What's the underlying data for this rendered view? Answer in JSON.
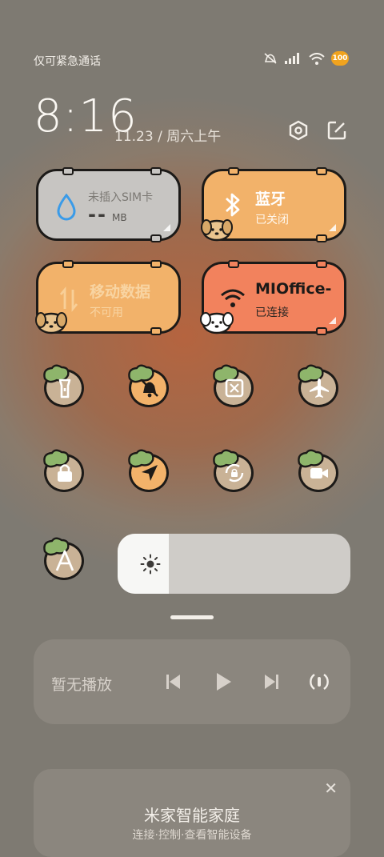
{
  "status_bar": {
    "carrier_text": "仅可紧急通话",
    "battery_level": "100",
    "icons": [
      "mute-icon",
      "signal-icon",
      "wifi-icon",
      "battery-icon"
    ]
  },
  "header": {
    "time": "8:16",
    "date": "11.23 / 周六上午",
    "icons": [
      "settings-icon",
      "edit-icon"
    ]
  },
  "tiles": {
    "sim": {
      "title": "未插入SIM卡",
      "value": "--",
      "unit": "MB",
      "icon": "water-drop-icon"
    },
    "bluetooth": {
      "title": "蓝牙",
      "status": "已关闭",
      "icon": "bluetooth-icon"
    },
    "mobile_data": {
      "title": "移动数据",
      "status": "不可用",
      "icon": "data-arrows-icon"
    },
    "wifi": {
      "title": "MIOffice-",
      "status": "已连接",
      "icon": "wifi-icon"
    }
  },
  "toggles_row1": [
    "flashlight-icon",
    "bell-mute-icon",
    "screenshot-icon",
    "airplane-icon"
  ],
  "toggles_row2": [
    "lock-icon",
    "location-icon",
    "rotation-lock-icon",
    "video-camera-icon"
  ],
  "auto_font_icon": "font-a-icon",
  "brightness": {
    "level": 0.22,
    "icon": "sun-icon"
  },
  "media": {
    "label": "暂无播放",
    "controls": [
      "previous-icon",
      "play-icon",
      "next-icon",
      "cast-icon"
    ]
  },
  "smart_home": {
    "title": "米家智能家庭",
    "subtitle": "连接·控制·查看智能设备",
    "close": "✕"
  },
  "colors": {
    "tile_gray": "#c7c5c2",
    "tile_orange": "#f2b26a",
    "tile_coral": "#f2825d",
    "accent_blue": "#3a9be8"
  }
}
